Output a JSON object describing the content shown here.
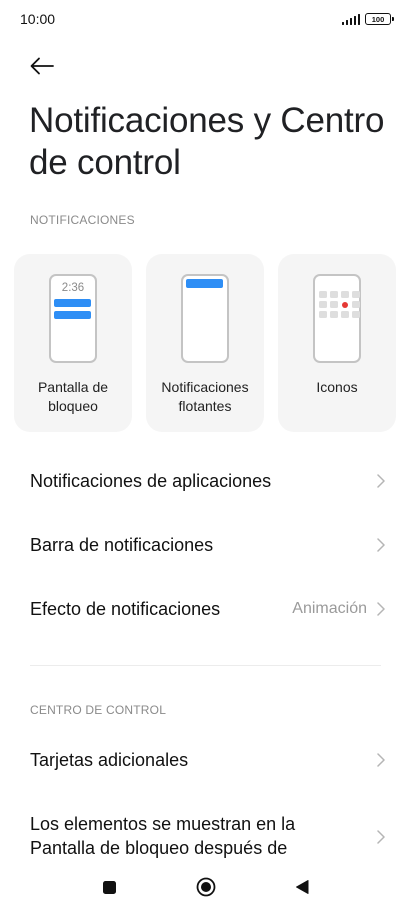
{
  "status": {
    "time": "10:00",
    "battery": "100"
  },
  "header": {
    "title": "Notificaciones y Centro de control"
  },
  "notifications_section": {
    "header": "NOTIFICACIONES",
    "cards": [
      {
        "label": "Pantalla de bloqueo",
        "preview_time": "2:36",
        "icon": "lock-screen-preview-icon"
      },
      {
        "label": "Notificaciones flotantes",
        "icon": "floating-notification-preview-icon"
      },
      {
        "label": "Iconos",
        "icon": "badge-icons-preview-icon"
      }
    ],
    "items": [
      {
        "label": "Notificaciones de aplicaciones",
        "value": ""
      },
      {
        "label": "Barra de notificaciones",
        "value": ""
      },
      {
        "label": "Efecto de notificaciones",
        "value": "Animación"
      }
    ]
  },
  "control_center_section": {
    "header": "CENTRO DE CONTROL",
    "items": [
      {
        "label": "Tarjetas adicionales"
      },
      {
        "label": "Los elementos se muestran en la Pantalla de bloqueo después de deslizar hacia abajo"
      }
    ]
  },
  "colors": {
    "accent": "#2e8ef5",
    "badge_dot": "#e53935",
    "card_bg": "#f5f5f5"
  }
}
